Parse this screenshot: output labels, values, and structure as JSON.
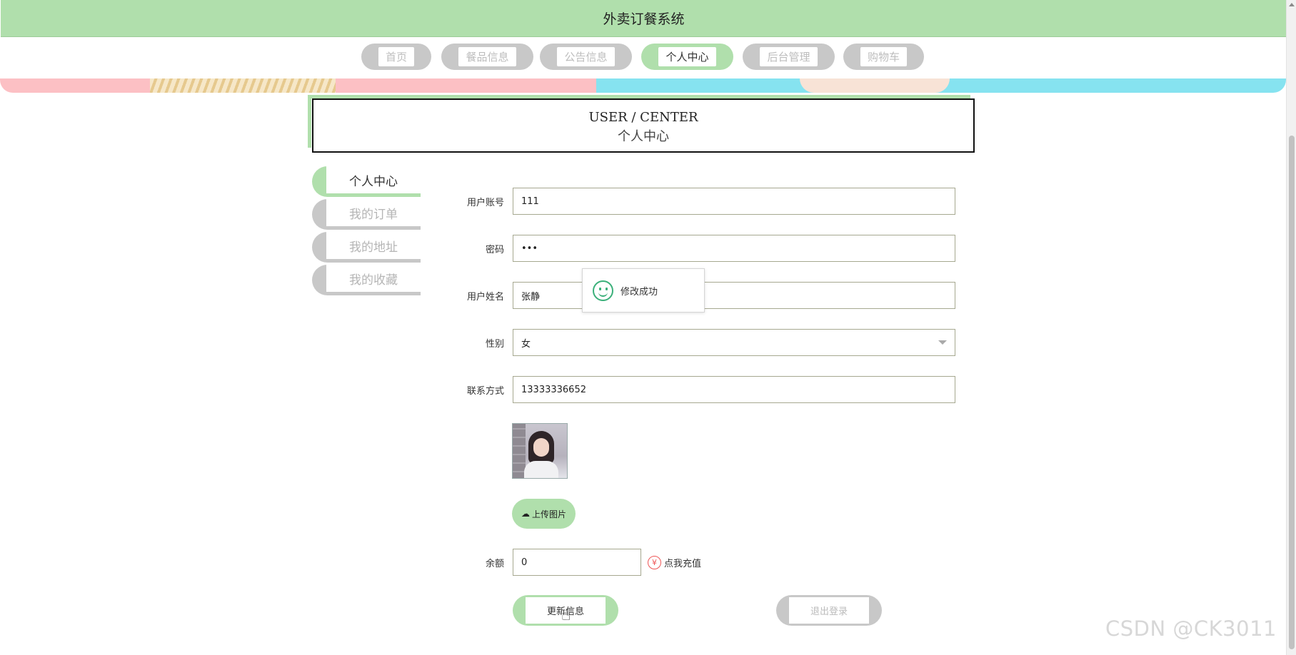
{
  "app": {
    "title": "外卖订餐系统"
  },
  "nav": {
    "items": [
      {
        "label": "首页",
        "active": false
      },
      {
        "label": "餐品信息",
        "active": false
      },
      {
        "label": "公告信息",
        "active": false
      },
      {
        "label": "个人中心",
        "active": true
      },
      {
        "label": "后台管理",
        "active": false
      },
      {
        "label": "购物车",
        "active": false
      }
    ]
  },
  "section": {
    "title_en": "USER / CENTER",
    "title_cn": "个人中心"
  },
  "sidebar": {
    "items": [
      {
        "label": "个人中心",
        "active": true
      },
      {
        "label": "我的订单",
        "active": false
      },
      {
        "label": "我的地址",
        "active": false
      },
      {
        "label": "我的收藏",
        "active": false
      }
    ]
  },
  "form": {
    "account": {
      "label": "用户账号",
      "value": "111"
    },
    "password": {
      "label": "密码",
      "value": "•••"
    },
    "name": {
      "label": "用户姓名",
      "value": "张静"
    },
    "gender": {
      "label": "性别",
      "value": "女"
    },
    "phone": {
      "label": "联系方式",
      "value": "13333336652"
    },
    "upload_label": "上传图片",
    "balance": {
      "label": "余额",
      "value": "0"
    },
    "recharge_label": "点我充值",
    "yen_symbol": "¥"
  },
  "actions": {
    "update_label": "更新信息",
    "logout_label": "退出登录"
  },
  "toast": {
    "message": "修改成功"
  },
  "watermark": "CSDN @CK3011",
  "colors": {
    "accent": "#b0dfac",
    "inactive": "#c8c8c8",
    "success": "#3bb07a",
    "recharge": "#ee5555"
  },
  "icons": {
    "upload": "cloud-upload-icon",
    "toast": "smile-icon",
    "recharge": "yen-icon",
    "select": "chevron-down-icon"
  }
}
